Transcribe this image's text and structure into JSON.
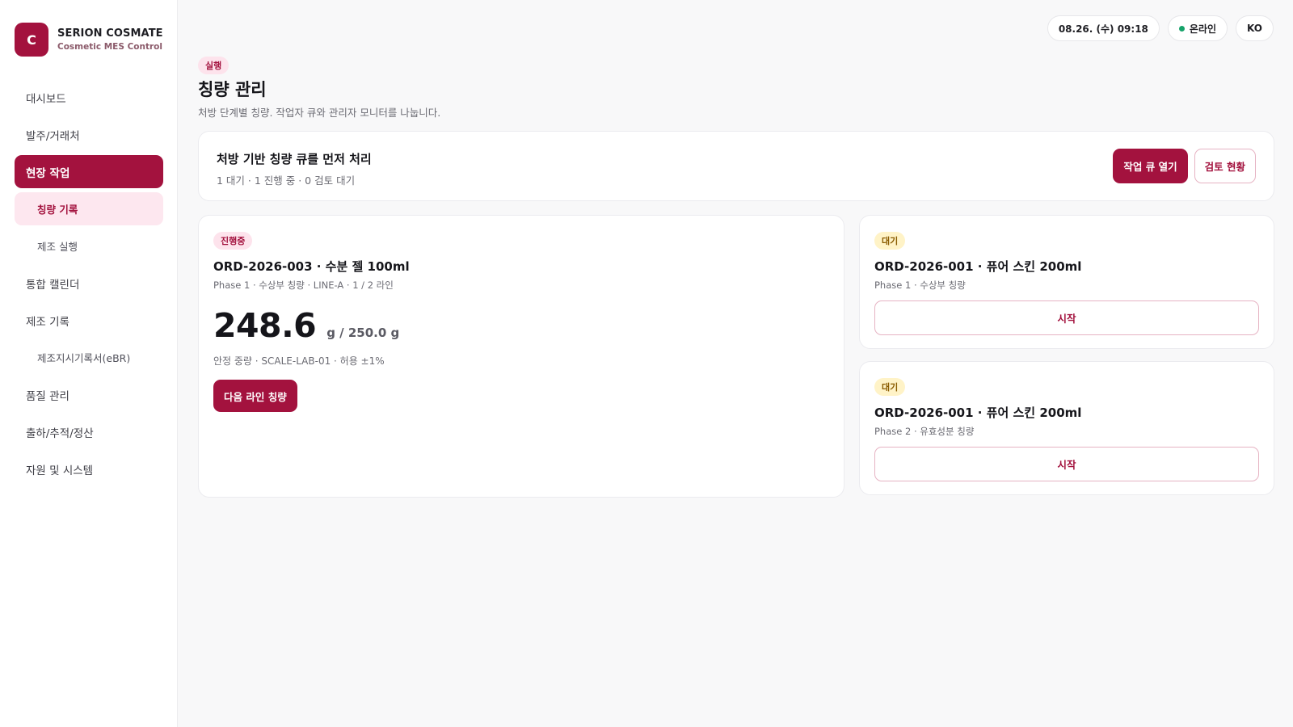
{
  "brand": {
    "logo_letter": "C",
    "name": "SERION COSMATE",
    "subtitle": "Cosmetic MES Control"
  },
  "sidebar": {
    "items": [
      {
        "label": "대시보드"
      },
      {
        "label": "발주/거래처"
      },
      {
        "label": "현장 작업"
      },
      {
        "label": "칭량 기록"
      },
      {
        "label": "제조 실행"
      },
      {
        "label": "통합 캘린더"
      },
      {
        "label": "제조 기록"
      },
      {
        "label": "제조지시기록서(eBR)"
      },
      {
        "label": "품질 관리"
      },
      {
        "label": "출하/추적/정산"
      },
      {
        "label": "자원 및 시스템"
      }
    ]
  },
  "topbar": {
    "datetime": "08.26. (수) 09:18",
    "status": "온라인",
    "language": "KO"
  },
  "header": {
    "badge": "실행",
    "title": "칭량 관리",
    "subtitle": "처방 단계별 칭량. 작업자 큐와 관리자 모니터를 나눕니다."
  },
  "summary": {
    "title": "처방 기반 칭량 큐를 먼저 처리",
    "stats": "1 대기 · 1 진행 중 · 0 검토 대기",
    "open_queue_label": "작업 큐 열기",
    "review_label": "검토 현황"
  },
  "active_task": {
    "badge": "진행중",
    "title": "ORD-2026-003 · 수분 젤 100ml",
    "meta": "Phase 1 · 수상부 칭량 · LINE-A · 1 / 2 라인",
    "weight": "248.6",
    "target": "g / 250.0 g",
    "note": "안정 중량 · SCALE-LAB-01 · 허용 ±1%",
    "next_label": "다음 라인 칭량"
  },
  "queue": [
    {
      "badge": "대기",
      "title": "ORD-2026-001 · 퓨어 스킨 200ml",
      "meta": "Phase 1 · 수상부 칭량",
      "start_label": "시작"
    },
    {
      "badge": "대기",
      "title": "ORD-2026-001 · 퓨어 스킨 200ml",
      "meta": "Phase 2 · 유효성분 칭량",
      "start_label": "시작"
    }
  ],
  "colors": {
    "accent": "#a3123e",
    "accent_soft": "#fde7ef",
    "online": "#16a36a",
    "waiting": "#fff3c7"
  }
}
